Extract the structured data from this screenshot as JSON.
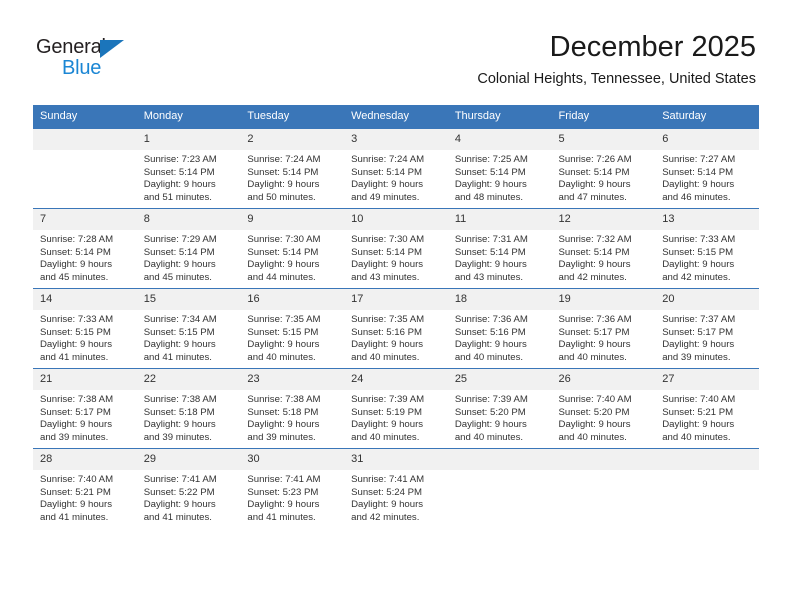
{
  "logo": {
    "word_one": "General",
    "word_two": "Blue",
    "triangle_color": "#1b75bb",
    "blue_color": "#1b86d4",
    "dark_color": "#231f20"
  },
  "header": {
    "title": "December 2025",
    "subtitle": "Colonial Heights, Tennessee, United States"
  },
  "theme": {
    "header_band": "#3a76b8",
    "daynum_band": "#f1f1f1",
    "text": "#333333",
    "page_bg": "#ffffff"
  },
  "calendar": {
    "weekday_headers": [
      "Sunday",
      "Monday",
      "Tuesday",
      "Wednesday",
      "Thursday",
      "Friday",
      "Saturday"
    ],
    "weeks": [
      [
        {
          "day": "",
          "lines": []
        },
        {
          "day": "1",
          "lines": [
            "Sunrise: 7:23 AM",
            "Sunset: 5:14 PM",
            "Daylight: 9 hours",
            "and 51 minutes."
          ]
        },
        {
          "day": "2",
          "lines": [
            "Sunrise: 7:24 AM",
            "Sunset: 5:14 PM",
            "Daylight: 9 hours",
            "and 50 minutes."
          ]
        },
        {
          "day": "3",
          "lines": [
            "Sunrise: 7:24 AM",
            "Sunset: 5:14 PM",
            "Daylight: 9 hours",
            "and 49 minutes."
          ]
        },
        {
          "day": "4",
          "lines": [
            "Sunrise: 7:25 AM",
            "Sunset: 5:14 PM",
            "Daylight: 9 hours",
            "and 48 minutes."
          ]
        },
        {
          "day": "5",
          "lines": [
            "Sunrise: 7:26 AM",
            "Sunset: 5:14 PM",
            "Daylight: 9 hours",
            "and 47 minutes."
          ]
        },
        {
          "day": "6",
          "lines": [
            "Sunrise: 7:27 AM",
            "Sunset: 5:14 PM",
            "Daylight: 9 hours",
            "and 46 minutes."
          ]
        }
      ],
      [
        {
          "day": "7",
          "lines": [
            "Sunrise: 7:28 AM",
            "Sunset: 5:14 PM",
            "Daylight: 9 hours",
            "and 45 minutes."
          ]
        },
        {
          "day": "8",
          "lines": [
            "Sunrise: 7:29 AM",
            "Sunset: 5:14 PM",
            "Daylight: 9 hours",
            "and 45 minutes."
          ]
        },
        {
          "day": "9",
          "lines": [
            "Sunrise: 7:30 AM",
            "Sunset: 5:14 PM",
            "Daylight: 9 hours",
            "and 44 minutes."
          ]
        },
        {
          "day": "10",
          "lines": [
            "Sunrise: 7:30 AM",
            "Sunset: 5:14 PM",
            "Daylight: 9 hours",
            "and 43 minutes."
          ]
        },
        {
          "day": "11",
          "lines": [
            "Sunrise: 7:31 AM",
            "Sunset: 5:14 PM",
            "Daylight: 9 hours",
            "and 43 minutes."
          ]
        },
        {
          "day": "12",
          "lines": [
            "Sunrise: 7:32 AM",
            "Sunset: 5:14 PM",
            "Daylight: 9 hours",
            "and 42 minutes."
          ]
        },
        {
          "day": "13",
          "lines": [
            "Sunrise: 7:33 AM",
            "Sunset: 5:15 PM",
            "Daylight: 9 hours",
            "and 42 minutes."
          ]
        }
      ],
      [
        {
          "day": "14",
          "lines": [
            "Sunrise: 7:33 AM",
            "Sunset: 5:15 PM",
            "Daylight: 9 hours",
            "and 41 minutes."
          ]
        },
        {
          "day": "15",
          "lines": [
            "Sunrise: 7:34 AM",
            "Sunset: 5:15 PM",
            "Daylight: 9 hours",
            "and 41 minutes."
          ]
        },
        {
          "day": "16",
          "lines": [
            "Sunrise: 7:35 AM",
            "Sunset: 5:15 PM",
            "Daylight: 9 hours",
            "and 40 minutes."
          ]
        },
        {
          "day": "17",
          "lines": [
            "Sunrise: 7:35 AM",
            "Sunset: 5:16 PM",
            "Daylight: 9 hours",
            "and 40 minutes."
          ]
        },
        {
          "day": "18",
          "lines": [
            "Sunrise: 7:36 AM",
            "Sunset: 5:16 PM",
            "Daylight: 9 hours",
            "and 40 minutes."
          ]
        },
        {
          "day": "19",
          "lines": [
            "Sunrise: 7:36 AM",
            "Sunset: 5:17 PM",
            "Daylight: 9 hours",
            "and 40 minutes."
          ]
        },
        {
          "day": "20",
          "lines": [
            "Sunrise: 7:37 AM",
            "Sunset: 5:17 PM",
            "Daylight: 9 hours",
            "and 39 minutes."
          ]
        }
      ],
      [
        {
          "day": "21",
          "lines": [
            "Sunrise: 7:38 AM",
            "Sunset: 5:17 PM",
            "Daylight: 9 hours",
            "and 39 minutes."
          ]
        },
        {
          "day": "22",
          "lines": [
            "Sunrise: 7:38 AM",
            "Sunset: 5:18 PM",
            "Daylight: 9 hours",
            "and 39 minutes."
          ]
        },
        {
          "day": "23",
          "lines": [
            "Sunrise: 7:38 AM",
            "Sunset: 5:18 PM",
            "Daylight: 9 hours",
            "and 39 minutes."
          ]
        },
        {
          "day": "24",
          "lines": [
            "Sunrise: 7:39 AM",
            "Sunset: 5:19 PM",
            "Daylight: 9 hours",
            "and 40 minutes."
          ]
        },
        {
          "day": "25",
          "lines": [
            "Sunrise: 7:39 AM",
            "Sunset: 5:20 PM",
            "Daylight: 9 hours",
            "and 40 minutes."
          ]
        },
        {
          "day": "26",
          "lines": [
            "Sunrise: 7:40 AM",
            "Sunset: 5:20 PM",
            "Daylight: 9 hours",
            "and 40 minutes."
          ]
        },
        {
          "day": "27",
          "lines": [
            "Sunrise: 7:40 AM",
            "Sunset: 5:21 PM",
            "Daylight: 9 hours",
            "and 40 minutes."
          ]
        }
      ],
      [
        {
          "day": "28",
          "lines": [
            "Sunrise: 7:40 AM",
            "Sunset: 5:21 PM",
            "Daylight: 9 hours",
            "and 41 minutes."
          ]
        },
        {
          "day": "29",
          "lines": [
            "Sunrise: 7:41 AM",
            "Sunset: 5:22 PM",
            "Daylight: 9 hours",
            "and 41 minutes."
          ]
        },
        {
          "day": "30",
          "lines": [
            "Sunrise: 7:41 AM",
            "Sunset: 5:23 PM",
            "Daylight: 9 hours",
            "and 41 minutes."
          ]
        },
        {
          "day": "31",
          "lines": [
            "Sunrise: 7:41 AM",
            "Sunset: 5:24 PM",
            "Daylight: 9 hours",
            "and 42 minutes."
          ]
        },
        {
          "day": "",
          "lines": []
        },
        {
          "day": "",
          "lines": []
        },
        {
          "day": "",
          "lines": []
        }
      ]
    ]
  }
}
